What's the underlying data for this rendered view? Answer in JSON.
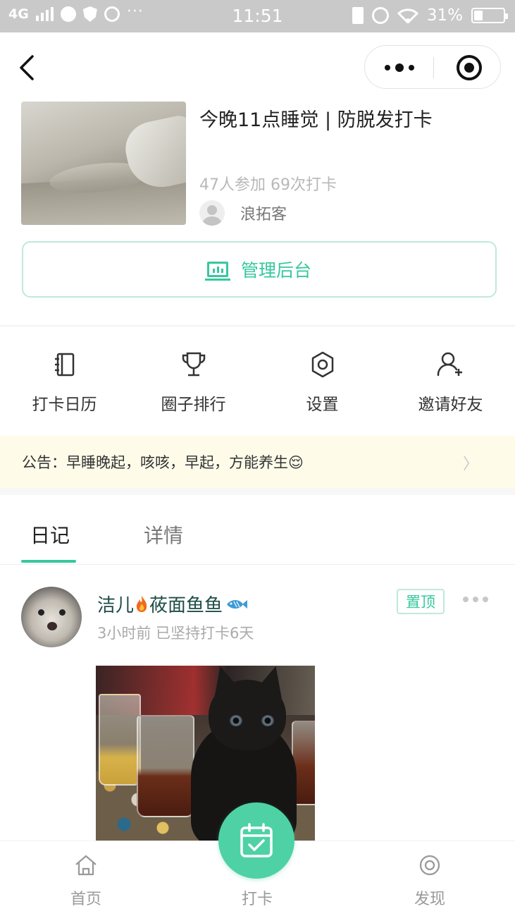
{
  "status_bar": {
    "network": "4G",
    "time": "11:51",
    "battery": "31%",
    "more": "···"
  },
  "capsule": {
    "more_icon": "more-dots-icon",
    "close_icon": "target-icon"
  },
  "circle": {
    "title": "今晚11点睡觉 | 防脱发打卡",
    "stats": "47人参加 69次打卡",
    "owner": "浪拓客",
    "admin_button": "管理后台"
  },
  "menu": [
    {
      "label": "打卡日历",
      "icon": "calendar-book-icon"
    },
    {
      "label": "圈子排行",
      "icon": "trophy-icon"
    },
    {
      "label": "设置",
      "icon": "gear-icon"
    },
    {
      "label": "邀请好友",
      "icon": "add-user-icon"
    }
  ],
  "notice": {
    "text": "公告：早睡晚起，咳咳，早起，方能养生😌",
    "arrow": "〉"
  },
  "tabs": [
    {
      "label": "日记",
      "active": true
    },
    {
      "label": "详情",
      "active": false
    }
  ],
  "post": {
    "author": "洁儿",
    "author_suffix": "莜面鱼鱼",
    "meta": "3小时前  已坚持打卡6天",
    "pin_label": "置顶"
  },
  "bottom_nav": [
    {
      "label": "首页",
      "icon": "home-icon"
    },
    {
      "label": "打卡",
      "icon": "calendar-check-icon"
    },
    {
      "label": "发现",
      "icon": "discover-icon"
    }
  ],
  "colors": {
    "accent": "#36c89e",
    "fab": "#4fd1a6",
    "notice_bg": "#fefbe9"
  }
}
